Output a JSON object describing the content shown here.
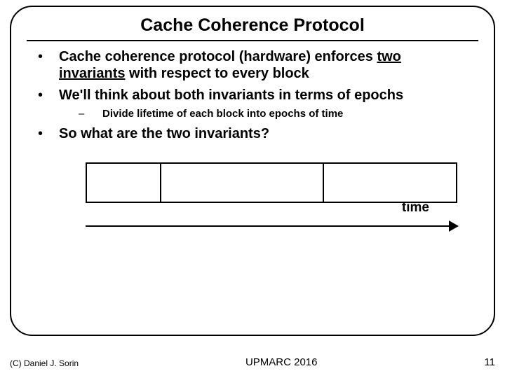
{
  "title": "Cache Coherence Protocol",
  "bullets": {
    "b1a_pre": "Cache coherence protocol (hardware) enforces ",
    "b1a_u": "two invariants",
    "b1a_post": " with respect to every block",
    "b1b": "We'll think about both invariants in terms of epochs",
    "b2a": "Divide lifetime of each block into epochs of time",
    "b1c": "So what are the two invariants?"
  },
  "diagram": {
    "axis_label": "time"
  },
  "footer": {
    "copyright": "(C) Daniel J. Sorin",
    "venue": "UPMARC 2016",
    "page": "11"
  }
}
